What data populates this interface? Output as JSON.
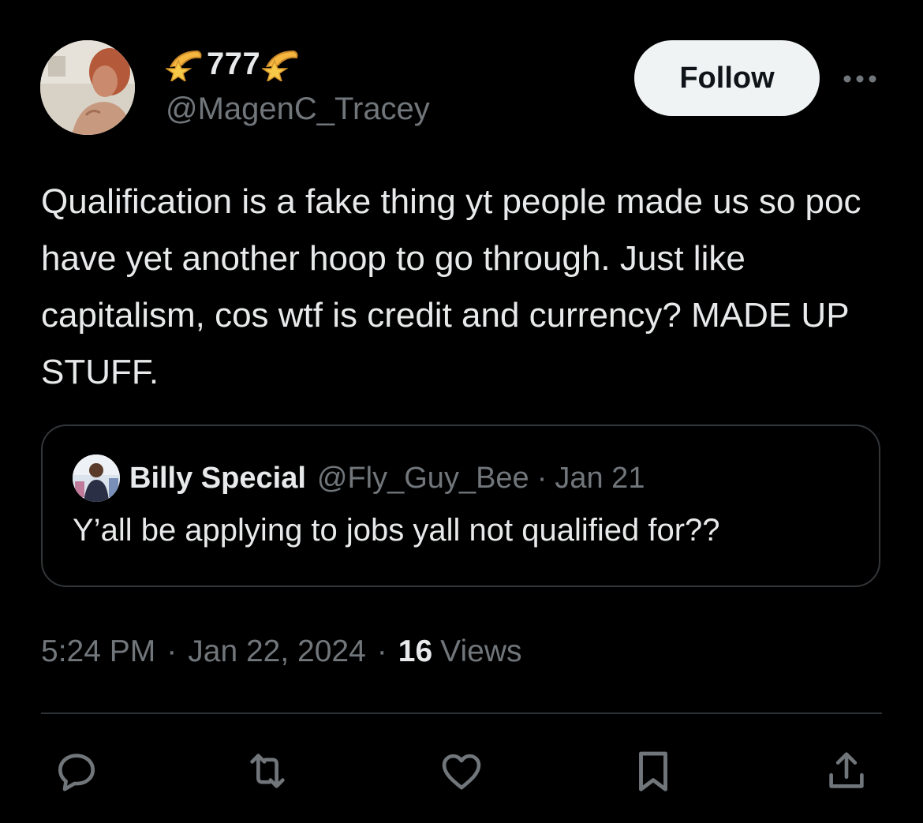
{
  "author": {
    "display_name": "777",
    "name_emoji": "star-shooting-icon",
    "handle": "@MagenC_Tracey",
    "avatar": "profile-photo"
  },
  "follow_button": {
    "label": "Follow"
  },
  "more_menu": {
    "icon": "more-horizontal-icon"
  },
  "tweet": {
    "text": "Qualification is a fake thing yt people made us so poc have yet another hoop to go through. Just like capitalism, cos wtf is credit and currency? MADE UP STUFF."
  },
  "quoted_tweet": {
    "display_name": "Billy Special",
    "handle": "@Fly_Guy_Bee",
    "separator": "·",
    "date": "Jan 21",
    "text": "Y’all be applying to jobs yall not qualified for??"
  },
  "meta": {
    "time": "5:24 PM",
    "separator": "·",
    "date": "Jan 22, 2024",
    "views_count": "16",
    "views_label": "Views"
  },
  "actions": [
    {
      "name": "reply",
      "icon": "reply-icon"
    },
    {
      "name": "retweet",
      "icon": "retweet-icon"
    },
    {
      "name": "like",
      "icon": "heart-icon"
    },
    {
      "name": "bookmark",
      "icon": "bookmark-icon"
    },
    {
      "name": "share",
      "icon": "share-icon"
    }
  ],
  "colors": {
    "background": "#000000",
    "primary_text": "#e7e9ea",
    "secondary_text": "#71767b",
    "border": "#333639",
    "follow_bg": "#eff3f4"
  }
}
